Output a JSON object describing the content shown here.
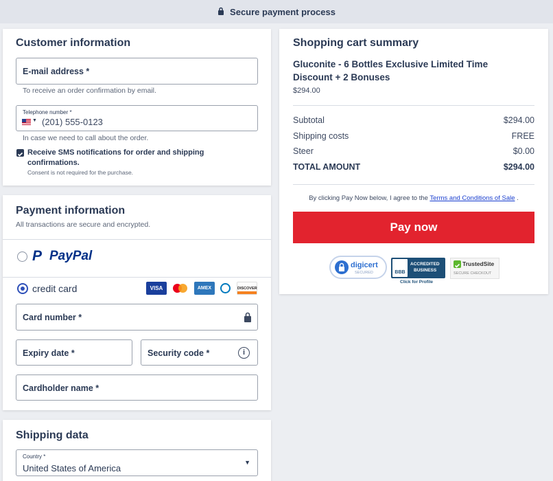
{
  "topbar": {
    "text": "Secure payment process",
    "icon": "lock-icon"
  },
  "customer": {
    "title": "Customer information",
    "email_label": "E-mail address *",
    "email_hint": "To receive an order confirmation by email.",
    "phone_label": "Telephone number *",
    "phone_placeholder": "(201) 555-0123",
    "phone_hint": "In case we need to call about the order.",
    "sms_label": "Receive SMS notifications for order and shipping confirmations.",
    "sms_consent": "Consent is not required for the purchase.",
    "sms_checked": true
  },
  "payment": {
    "title": "Payment information",
    "subtitle": "All transactions are secure and encrypted.",
    "paypal_label": "PayPal",
    "credit_label": "credit card",
    "card_icons": [
      "VISA",
      "mastercard",
      "AMEX",
      "diners",
      "DISCOVER"
    ],
    "card_number_label": "Card number *",
    "expiry_label": "Expiry date *",
    "security_label": "Security code *",
    "holder_label": "Cardholder name *"
  },
  "shipping": {
    "title": "Shipping data",
    "country_label": "Country *",
    "country_value": "United States of America"
  },
  "cart": {
    "title": "Shopping cart summary",
    "product_name": "Gluconite - 6 Bottles Exclusive Limited Time Discount + 2 Bonuses",
    "product_price": "$294.00",
    "rows": [
      {
        "label": "Subtotal",
        "value": "$294.00"
      },
      {
        "label": "Shipping costs",
        "value": "FREE"
      },
      {
        "label": "Steer",
        "value": "$0.00"
      },
      {
        "label": "TOTAL AMOUNT",
        "value": "$294.00"
      }
    ],
    "agree_text": "By clicking Pay Now below, I agree to the",
    "agree_link": "Terms and Conditions of Sale",
    "agree_end": ".",
    "pay_button": "Pay now",
    "badges": {
      "digicert": "digicert",
      "digicert_sub": "SECURED",
      "bbb_line1": "ACCREDITED",
      "bbb_line2": "BUSINESS",
      "bbb_click": "Click for Profile",
      "trusted": "TrustedSite",
      "trusted_sub": "SECURE CHECKOUT"
    }
  },
  "colors": {
    "accent": "#2d4fb8",
    "pay": "#e2232e",
    "text": "#2b3a55"
  }
}
